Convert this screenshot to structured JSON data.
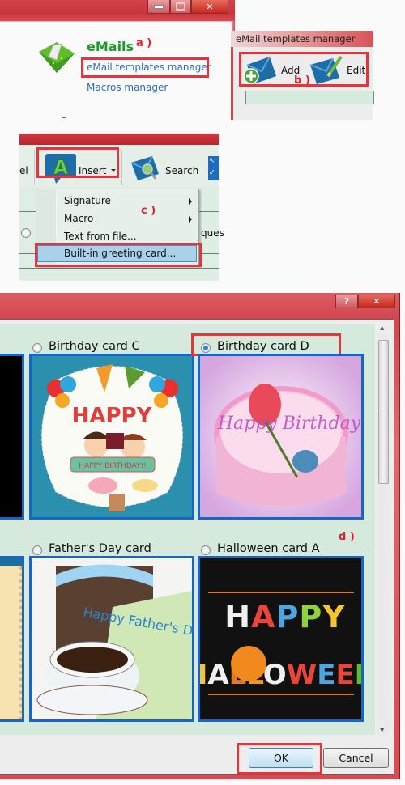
{
  "panel_a": {
    "window_controls": {
      "minimize": "minimize-icon",
      "maximize": "maximize-icon",
      "close": "close-icon"
    },
    "section_title": "eMails",
    "links": [
      "eMail templates manager",
      "Macros manager"
    ],
    "annotation": "a )"
  },
  "panel_b": {
    "window_title": "eMail templates manager",
    "buttons": [
      {
        "label": "Add",
        "icon": "envelope-add-icon"
      },
      {
        "label": "Edit",
        "icon": "envelope-edit-icon"
      }
    ],
    "annotation": "b )"
  },
  "panel_c": {
    "toolbar_left_fragment": "el",
    "insert_label": "Insert",
    "search_label": "Search",
    "menu_items": [
      {
        "label": "Signature",
        "submenu": true
      },
      {
        "label": "Macro",
        "submenu": true
      },
      {
        "label": "Text from file...",
        "submenu": false
      },
      {
        "label": "Built-in greeting card...",
        "submenu": false,
        "highlighted": true
      }
    ],
    "background_fragment": "ques",
    "annotation": "c )"
  },
  "panel_d": {
    "title_buttons": {
      "help": "?",
      "close": "close-icon"
    },
    "cards": [
      {
        "label": "Birthday card C",
        "selected": false
      },
      {
        "label": "Birthday card D",
        "selected": true
      },
      {
        "label": "Father's Day card",
        "selected": false
      },
      {
        "label": "Halloween card A",
        "selected": false
      }
    ],
    "card_texts": {
      "birthday_c": "HAPPY BIRTHDAY!!",
      "birthday_d": "Happy Birthday",
      "fathers_day": "Happy Father's Day",
      "halloween": "HAPPY HALLOWEEN"
    },
    "annotation": "d )",
    "ok_label": "OK",
    "cancel_label": "Cancel"
  },
  "colors": {
    "annotation_red": "#e0202e",
    "accent_blue": "#1466c8",
    "title_red": "#d2424b",
    "grid_bg": "#d5e9dc"
  }
}
